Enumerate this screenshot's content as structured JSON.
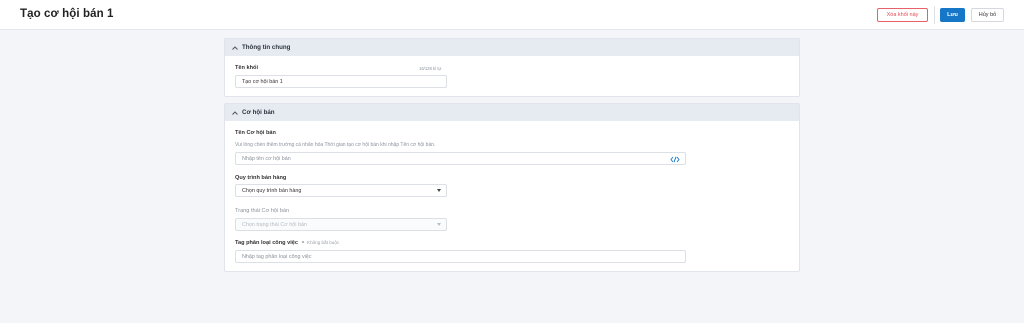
{
  "header": {
    "title": "Tạo cơ hội bán 1",
    "delete_label": "Xóa khối này",
    "save_label": "Lưu",
    "cancel_label": "Hủy bỏ"
  },
  "general": {
    "section_title": "Thông tin chung",
    "name_label": "Tên khối",
    "name_counter": "16/128 kí tự",
    "name_value": "Tạo cơ hội bán 1"
  },
  "opportunity": {
    "section_title": "Cơ hội bán",
    "name_label": "Tên Cơ hội bán",
    "name_hint": "Vui lòng chèn thêm trường cá nhân hóa Thời gian tạo cơ hội bán khi nhập Tên cơ hội bán.",
    "name_placeholder": "Nhập tên cơ hội bán",
    "pipeline_label": "Quy trình bán hàng",
    "pipeline_value": "Chọn quy trình bán hàng",
    "status_label": "Trạng thái Cơ hội bán",
    "status_value": "Chọn trạng thái Cơ hội bán",
    "tag_label": "Tag phân loại công việc",
    "tag_optional": "Không bắt buộc",
    "tag_placeholder": "Nhập tag phân loại công việc"
  },
  "colors": {
    "primary": "#1677c9",
    "danger": "#e24b55",
    "section_header_bg": "#e6ebf1",
    "page_bg": "#f3f5f9"
  },
  "icons": [
    "chevron-up-icon",
    "code-icon",
    "dropdown-caret-icon"
  ]
}
